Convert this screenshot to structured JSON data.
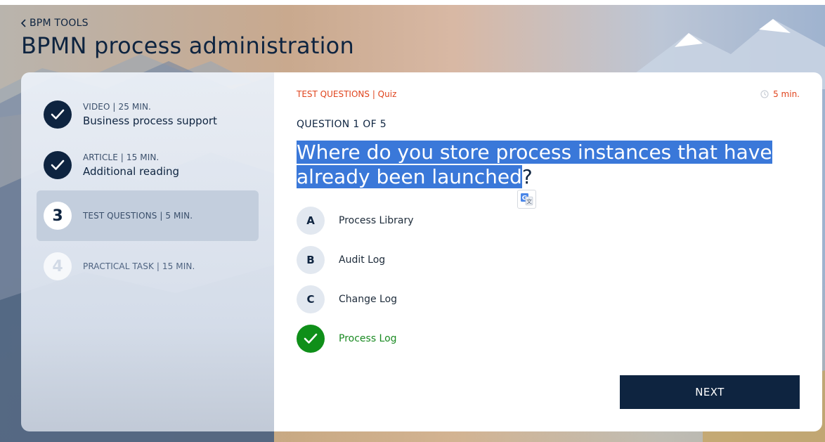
{
  "header": {
    "back_label": "BPM TOOLS",
    "title": "BPMN process administration"
  },
  "sidebar": {
    "steps": [
      {
        "number": "",
        "meta": "VIDEO | 25 MIN.",
        "name": "Business process support",
        "state": "done"
      },
      {
        "number": "",
        "meta": "ARTICLE | 15 MIN.",
        "name": "Additional reading",
        "state": "done"
      },
      {
        "number": "3",
        "meta": "TEST QUESTIONS | 5 MIN.",
        "name": "",
        "state": "current"
      },
      {
        "number": "4",
        "meta": "PRACTICAL TASK | 15 MIN.",
        "name": "",
        "state": "todo"
      }
    ]
  },
  "quiz": {
    "breadcrumb": "TEST QUESTIONS | Quiz",
    "timer": "5 min.",
    "question_count": "QUESTION 1 OF 5",
    "question_selected": "Where do you store process instances that have already been launched",
    "question_rest": "?",
    "options": [
      {
        "letter": "A",
        "label": "Process Library",
        "correct": false
      },
      {
        "letter": "B",
        "label": "Audit Log",
        "correct": false
      },
      {
        "letter": "C",
        "label": "Change Log",
        "correct": false
      },
      {
        "letter": "",
        "label": "Process Log",
        "correct": true
      }
    ],
    "next_label": "NEXT"
  },
  "icons": {
    "back": "chevron-left-icon",
    "check": "checkmark-icon",
    "clock": "clock-icon",
    "translate": "google-translate-icon"
  },
  "colors": {
    "navy": "#0e2440",
    "accent_orange": "#e0441d",
    "correct_green": "#0f8f19",
    "selection_blue": "#3a78d9"
  }
}
